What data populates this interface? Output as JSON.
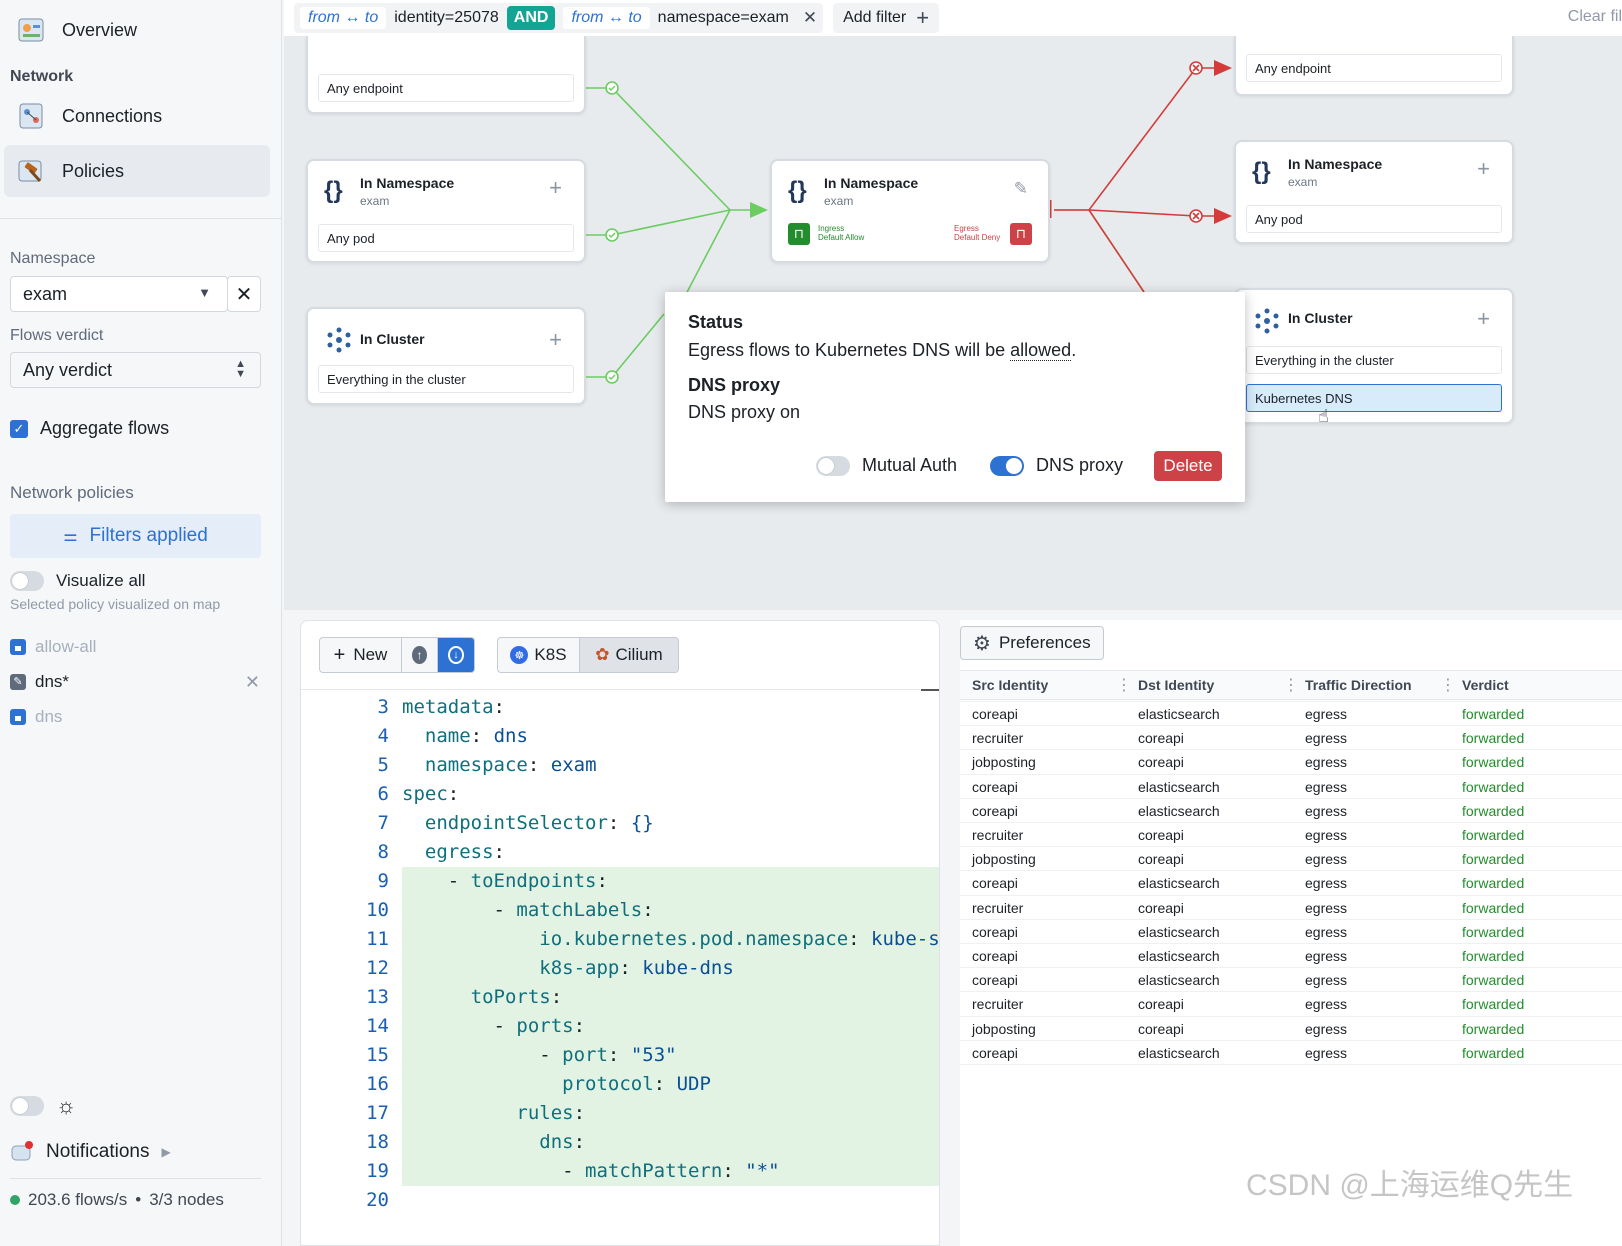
{
  "sidebar": {
    "overview_label": "Overview",
    "network_heading": "Network",
    "connections_label": "Connections",
    "policies_label": "Policies",
    "namespace_label": "Namespace",
    "namespace_value": "exam",
    "flows_verdict_label": "Flows verdict",
    "verdict_value": "Any verdict",
    "aggregate_label": "Aggregate flows",
    "network_policies_label": "Network policies",
    "filters_applied_label": "Filters applied",
    "visualize_all_label": "Visualize all",
    "visualize_hint": "Selected policy visualized on map",
    "policies": [
      {
        "name": "allow-all",
        "icon": "lock-icon",
        "active": false
      },
      {
        "name": "dns*",
        "icon": "edit-icon",
        "active": true
      },
      {
        "name": "dns",
        "icon": "lock-icon",
        "active": false
      }
    ],
    "notifications_label": "Notifications",
    "status_flows": "203.6 flows/s",
    "status_nodes": "3/3 nodes"
  },
  "filterbar": {
    "chip1_dir": "from ↔ to",
    "chip1_value": "identity=25078",
    "and_label": "AND",
    "chip2_dir": "from ↔ to",
    "chip2_value": "namespace=exam",
    "add_filter_label": "Add filter",
    "clear_label": "Clear fil"
  },
  "map": {
    "left_cards": [
      {
        "row": "Any endpoint"
      },
      {
        "title": "In Namespace",
        "sub": "exam",
        "row": "Any pod"
      },
      {
        "title": "In Cluster",
        "row": "Everything in the cluster"
      }
    ],
    "center": {
      "title": "In Namespace",
      "sub": "exam",
      "ingress": "Ingress",
      "ingress2": "Default Allow",
      "egress": "Egress",
      "egress2": "Default Deny"
    },
    "right_cards": [
      {
        "row": "Any endpoint"
      },
      {
        "title": "In Namespace",
        "sub": "exam",
        "row": "Any pod"
      },
      {
        "title": "In Cluster",
        "row": "Everything in the cluster",
        "row2": "Kubernetes DNS"
      }
    ]
  },
  "popover": {
    "status_heading": "Status",
    "status_text_prefix": "Egress flows to Kubernetes DNS will be ",
    "status_text_word": "allowed",
    "status_text_suffix": ".",
    "dns_heading": "DNS proxy",
    "dns_text": "DNS proxy on",
    "mutual_auth_label": "Mutual Auth",
    "dns_proxy_label": "DNS proxy",
    "delete_label": "Delete"
  },
  "editor": {
    "new_label": "New",
    "k8s_label": "K8S",
    "cilium_label": "Cilium",
    "lines": [
      {
        "n": "3",
        "indent": "",
        "key": "metadata",
        "val": "",
        "hl": false
      },
      {
        "n": "4",
        "indent": "  ",
        "key": "name",
        "val": "dns",
        "hl": false
      },
      {
        "n": "5",
        "indent": "  ",
        "key": "namespace",
        "val": "exam",
        "hl": false
      },
      {
        "n": "6",
        "indent": "",
        "key": "spec",
        "val": "",
        "hl": false
      },
      {
        "n": "7",
        "indent": "  ",
        "key": "endpointSelector",
        "val": "{}",
        "hl": false
      },
      {
        "n": "8",
        "indent": "  ",
        "key": "egress",
        "val": "",
        "hl": false
      },
      {
        "n": "9",
        "indent": "    - ",
        "key": "toEndpoints",
        "val": "",
        "hl": true
      },
      {
        "n": "10",
        "indent": "        - ",
        "key": "matchLabels",
        "val": "",
        "hl": true
      },
      {
        "n": "11",
        "indent": "            ",
        "key": "io.kubernetes.pod.namespace",
        "val": "kube-s",
        "hl": true
      },
      {
        "n": "12",
        "indent": "            ",
        "key": "k8s-app",
        "val": "kube-dns",
        "hl": true
      },
      {
        "n": "13",
        "indent": "      ",
        "key": "toPorts",
        "val": "",
        "hl": true
      },
      {
        "n": "14",
        "indent": "        - ",
        "key": "ports",
        "val": "",
        "hl": true
      },
      {
        "n": "15",
        "indent": "            - ",
        "key": "port",
        "val": "\"53\"",
        "hl": true
      },
      {
        "n": "16",
        "indent": "              ",
        "key": "protocol",
        "val": "UDP",
        "hl": true
      },
      {
        "n": "17",
        "indent": "          ",
        "key": "rules",
        "val": "",
        "hl": true
      },
      {
        "n": "18",
        "indent": "            ",
        "key": "dns",
        "val": "",
        "hl": true
      },
      {
        "n": "19",
        "indent": "              - ",
        "key": "matchPattern",
        "val": "\"*\"",
        "hl": true
      },
      {
        "n": "20",
        "indent": "",
        "key": "",
        "val": "",
        "hl": false
      }
    ]
  },
  "flows": {
    "preferences_label": "Preferences",
    "columns": [
      "Src Identity",
      "Dst Identity",
      "Traffic Direction",
      "Verdict"
    ],
    "rows": [
      [
        "coreapi",
        "elasticsearch",
        "egress",
        "forwarded"
      ],
      [
        "recruiter",
        "coreapi",
        "egress",
        "forwarded"
      ],
      [
        "jobposting",
        "coreapi",
        "egress",
        "forwarded"
      ],
      [
        "coreapi",
        "elasticsearch",
        "egress",
        "forwarded"
      ],
      [
        "coreapi",
        "elasticsearch",
        "egress",
        "forwarded"
      ],
      [
        "recruiter",
        "coreapi",
        "egress",
        "forwarded"
      ],
      [
        "jobposting",
        "coreapi",
        "egress",
        "forwarded"
      ],
      [
        "coreapi",
        "elasticsearch",
        "egress",
        "forwarded"
      ],
      [
        "recruiter",
        "coreapi",
        "egress",
        "forwarded"
      ],
      [
        "coreapi",
        "elasticsearch",
        "egress",
        "forwarded"
      ],
      [
        "coreapi",
        "elasticsearch",
        "egress",
        "forwarded"
      ],
      [
        "coreapi",
        "elasticsearch",
        "egress",
        "forwarded"
      ],
      [
        "recruiter",
        "coreapi",
        "egress",
        "forwarded"
      ],
      [
        "jobposting",
        "coreapi",
        "egress",
        "forwarded"
      ],
      [
        "coreapi",
        "elasticsearch",
        "egress",
        "forwarded"
      ]
    ]
  },
  "watermark": "CSDN @上海运维Q先生",
  "colors": {
    "accent": "#2d72d2",
    "allow": "#238c2c",
    "deny": "#cd4246",
    "teal": "#13a594"
  }
}
